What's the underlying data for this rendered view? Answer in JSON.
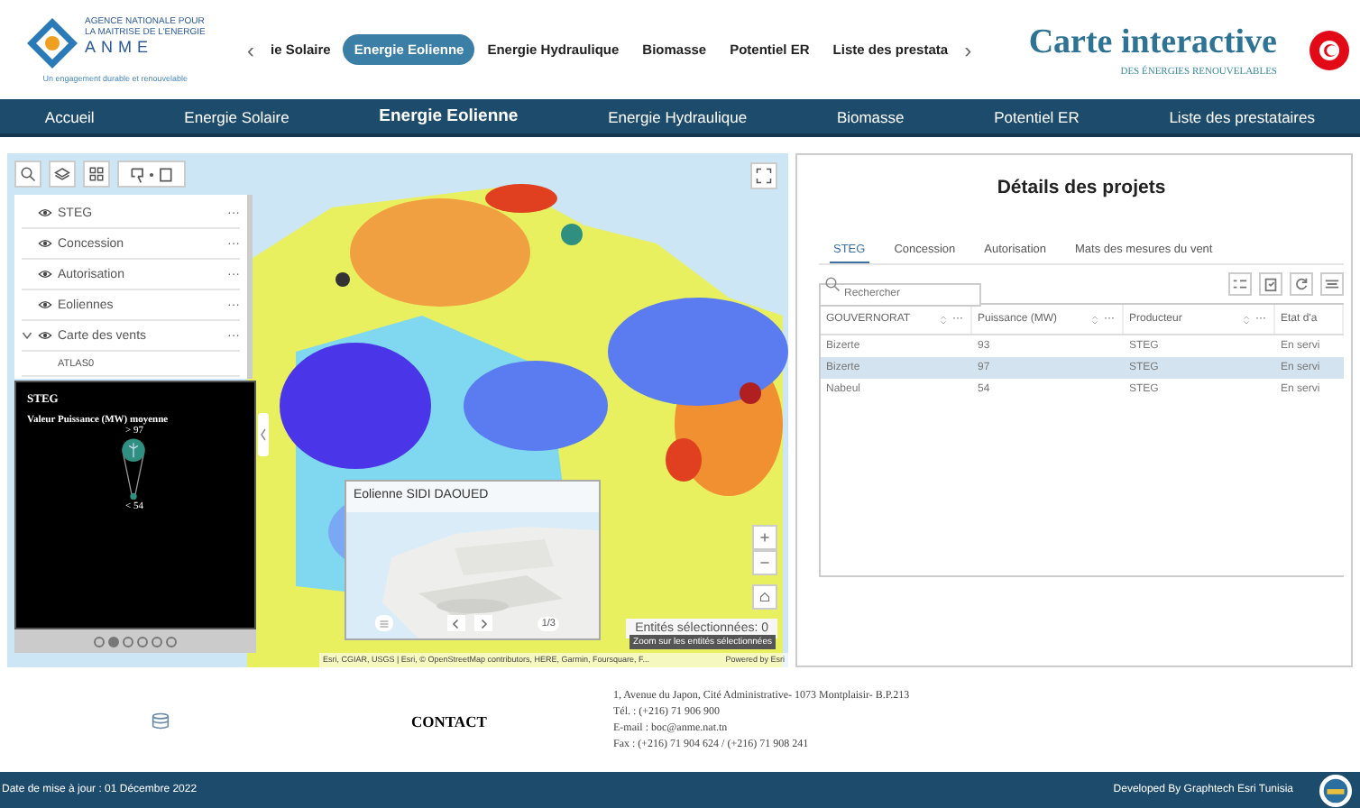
{
  "header": {
    "logo": {
      "line_1": "AGENCE NATIONALE POUR",
      "line_2": "LA MAITRISE DE L'ENERGIE",
      "acronym": "ANME",
      "slogan": "Un engagement durable et renouvelable"
    },
    "prev": "‹",
    "next": "›",
    "tabs": [
      {
        "label": "ie Solaire",
        "selected": false
      },
      {
        "label": "Energie Eolienne",
        "selected": true
      },
      {
        "label": "Energie Hydraulique",
        "selected": false
      },
      {
        "label": "Biomasse",
        "selected": false
      },
      {
        "label": "Potentiel ER",
        "selected": false
      },
      {
        "label": "Liste des prestata",
        "selected": false
      }
    ],
    "title": "Carte interactive",
    "subtitle": "DES ÉNERGIES RENOUVELABLES"
  },
  "nav": [
    {
      "label": "Accueil",
      "selected": false
    },
    {
      "label": "Energie Solaire",
      "selected": false
    },
    {
      "label": "Energie Eolienne",
      "selected": true
    },
    {
      "label": "Energie Hydraulique",
      "selected": false
    },
    {
      "label": "Biomasse",
      "selected": false
    },
    {
      "label": "Potentiel ER",
      "selected": false
    },
    {
      "label": "Liste des prestataires",
      "selected": false
    }
  ],
  "map": {
    "layers": [
      {
        "name": "STEG",
        "expanded": false
      },
      {
        "name": "Concession",
        "expanded": false
      },
      {
        "name": "Autorisation",
        "expanded": false
      },
      {
        "name": "Eoliennes",
        "expanded": false
      },
      {
        "name": "Carte des vents",
        "expanded": true,
        "children": [
          {
            "name": "ATLAS0"
          }
        ]
      }
    ],
    "more": "···",
    "legend": {
      "title": "STEG",
      "subtitle": "Valeur Puissance (MW) moyenne",
      "max": "> 97",
      "min": "< 54"
    },
    "pages": [
      {
        "selected": false
      },
      {
        "selected": true
      },
      {
        "selected": false
      },
      {
        "selected": false
      },
      {
        "selected": false
      },
      {
        "selected": false
      }
    ],
    "popup": {
      "title": "Eolienne SIDI DAOUED",
      "counter": "1/3"
    },
    "selection": "Entités sélectionnées: 0",
    "tooltip": "Zoom sur les entités sélectionnées",
    "attribution": "Esri, CGIAR, USGS | Esri, © OpenStreetMap contributors, HERE, Garmin, Foursquare, F...",
    "powered": "Powered by Esri"
  },
  "details": {
    "title": "Détails des projets",
    "tabs": [
      {
        "label": "STEG",
        "selected": true
      },
      {
        "label": "Concession",
        "selected": false
      },
      {
        "label": "Autorisation",
        "selected": false
      },
      {
        "label": "Mats des mesures du vent",
        "selected": false
      }
    ],
    "search": {
      "placeholder": "Rechercher"
    },
    "columns": [
      "GOUVERNORAT",
      "Puissance (MW)",
      "Producteur",
      "Etat d'a"
    ],
    "rows": [
      {
        "cells": [
          "Bizerte",
          "93",
          "STEG",
          "En servi"
        ],
        "selected": false
      },
      {
        "cells": [
          "Bizerte",
          "97",
          "STEG",
          "En servi"
        ],
        "selected": true
      },
      {
        "cells": [
          "Nabeul",
          "54",
          "STEG",
          "En servi"
        ],
        "selected": false
      }
    ]
  },
  "footer": {
    "contact": "CONTACT",
    "address": [
      "1, Avenue du Japon,  Cité Administrative- 1073 Montplaisir- B.P.213",
      "Tél. : (+216) 71 906 900",
      "E-mail : boc@anme.nat.tn",
      "Fax : (+216) 71 904 624 / (+216) 71 908 241"
    ],
    "updated": "Date de mise à jour : 01 Décembre 2022",
    "credit": "Developed By Graphtech Esri Tunisia"
  }
}
